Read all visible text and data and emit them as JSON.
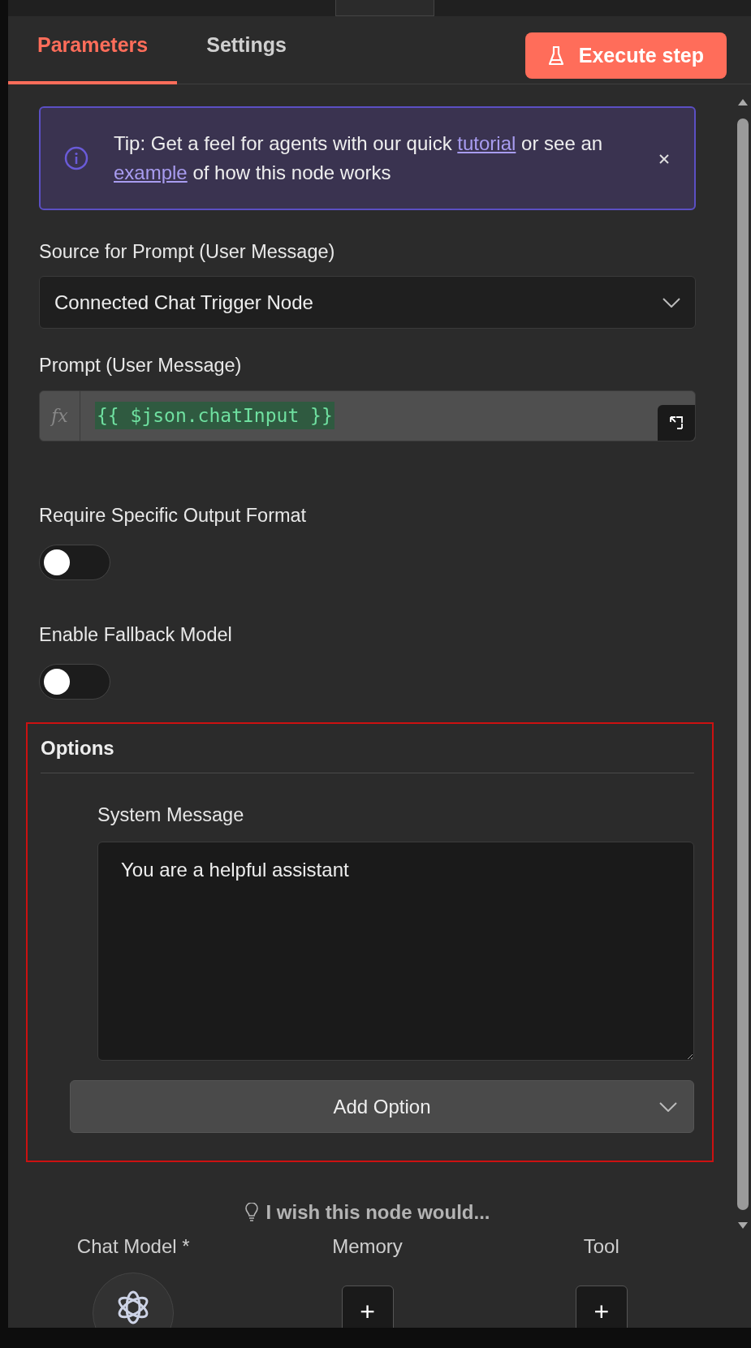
{
  "tabs": [
    {
      "label": "Parameters",
      "selected": true
    },
    {
      "label": "Settings",
      "selected": false
    }
  ],
  "execute_button": {
    "label": "Execute step"
  },
  "tip": {
    "segments": [
      {
        "text": "Tip: Get a feel for agents with our quick ",
        "link": false
      },
      {
        "text": "tutorial",
        "link": true
      },
      {
        "text": " or see an ",
        "link": false
      },
      {
        "text": "example",
        "link": true
      },
      {
        "text": " of how this node works",
        "link": false
      }
    ]
  },
  "fields": [
    {
      "kind": "select",
      "label": "Source for Prompt (User Message)",
      "value": "Connected Chat Trigger Node"
    },
    {
      "kind": "expression",
      "label": "Prompt (User Message)",
      "prefix": "fx",
      "value": "{{ $json.chatInput }}"
    },
    {
      "kind": "toggle",
      "label": "Require Specific Output Format",
      "on": false
    },
    {
      "kind": "toggle",
      "label": "Enable Fallback Model",
      "on": false
    }
  ],
  "options": {
    "title": "Options",
    "highlighted": true,
    "system_message": {
      "label": "System Message",
      "value": "You are a helpful assistant"
    },
    "add_button": {
      "label": "Add Option"
    }
  },
  "feedback_link": {
    "label": "I wish this node would..."
  },
  "connections": [
    {
      "label": "Chat Model *",
      "kind": "model"
    },
    {
      "label": "Memory",
      "kind": "add",
      "button": "+"
    },
    {
      "label": "Tool",
      "kind": "add",
      "button": "+"
    }
  ]
}
